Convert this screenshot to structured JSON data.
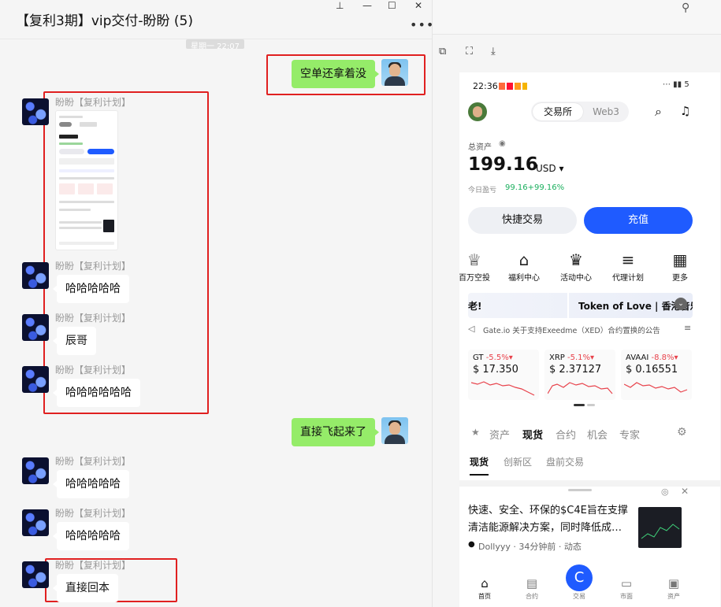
{
  "chat": {
    "title": "【复利3期】vip交付-盼盼 (5)",
    "timestamp": "星期一 22:07",
    "more": "•••",
    "window_controls": [
      "⊥",
      "—",
      "☐",
      "✕"
    ],
    "messages": [
      {
        "from": "me",
        "text": "空单还拿着没"
      },
      {
        "from": "them",
        "sender": "盼盼【复利计划】",
        "type": "image"
      },
      {
        "from": "them",
        "sender": "盼盼【复利计划】",
        "text": "哈哈哈哈哈"
      },
      {
        "from": "them",
        "sender": "盼盼【复利计划】",
        "text": "辰哥"
      },
      {
        "from": "them",
        "sender": "盼盼【复利计划】",
        "text": "哈哈哈哈哈哈"
      },
      {
        "from": "me",
        "text": "直接飞起来了"
      },
      {
        "from": "them",
        "sender": "盼盼【复利计划】",
        "text": "哈哈哈哈哈"
      },
      {
        "from": "them",
        "sender": "盼盼【复利计划】",
        "text": "哈哈哈哈哈"
      },
      {
        "from": "them",
        "sender": "盼盼【复利计划】",
        "text": "直接回本"
      }
    ]
  },
  "phone": {
    "status_time": "22:36",
    "status_right": "⋯ ▮▮ 5",
    "tabs": [
      "交易所",
      "Web3"
    ],
    "asset_label": "总资产",
    "asset_value": "199.16",
    "asset_unit": "USD ▾",
    "pnl_label": "今日盈亏",
    "pnl_value": "99.16+99.16%",
    "quick_trade": "快捷交易",
    "deposit": "充值",
    "quick_actions": [
      {
        "icon": "♕",
        "label": "百万空投"
      },
      {
        "icon": "⌂",
        "label": "福利中心"
      },
      {
        "icon": "♛",
        "label": "活动中心"
      },
      {
        "icon": "≡",
        "label": "代理计划"
      },
      {
        "icon": "▦",
        "label": "更多"
      }
    ],
    "banner_left": "老!",
    "banner_text": "Token of Love | 香港音乐节",
    "notice": "Gate.io 关于支持Exeedme（XED）合约置换的公告",
    "tickers": [
      {
        "name": "GT",
        "change": "-5.5%▾",
        "price": "$ 17.350"
      },
      {
        "name": "XRP",
        "change": "-5.1%▾",
        "price": "$ 2.37127"
      },
      {
        "name": "AVAAI",
        "change": "-8.8%▾",
        "price": "$ 0.16551"
      }
    ],
    "market_tabs": [
      "资产",
      "现货",
      "合约",
      "机会",
      "专家"
    ],
    "sub_tabs": [
      "现货",
      "创新区",
      "盘前交易"
    ],
    "news_text": "快速、安全、环保的$C4E旨在支撑清洁能源解决方案，同时降低成…",
    "news_author": "Dollyyy",
    "news_meta": "· 34分钟前 · 动态",
    "nav": [
      "首页",
      "合约",
      "交易",
      "市面",
      "资产"
    ],
    "colors": {
      "accent": "#1f5bff",
      "down": "#e8424b",
      "up": "#1aaf5d"
    }
  }
}
